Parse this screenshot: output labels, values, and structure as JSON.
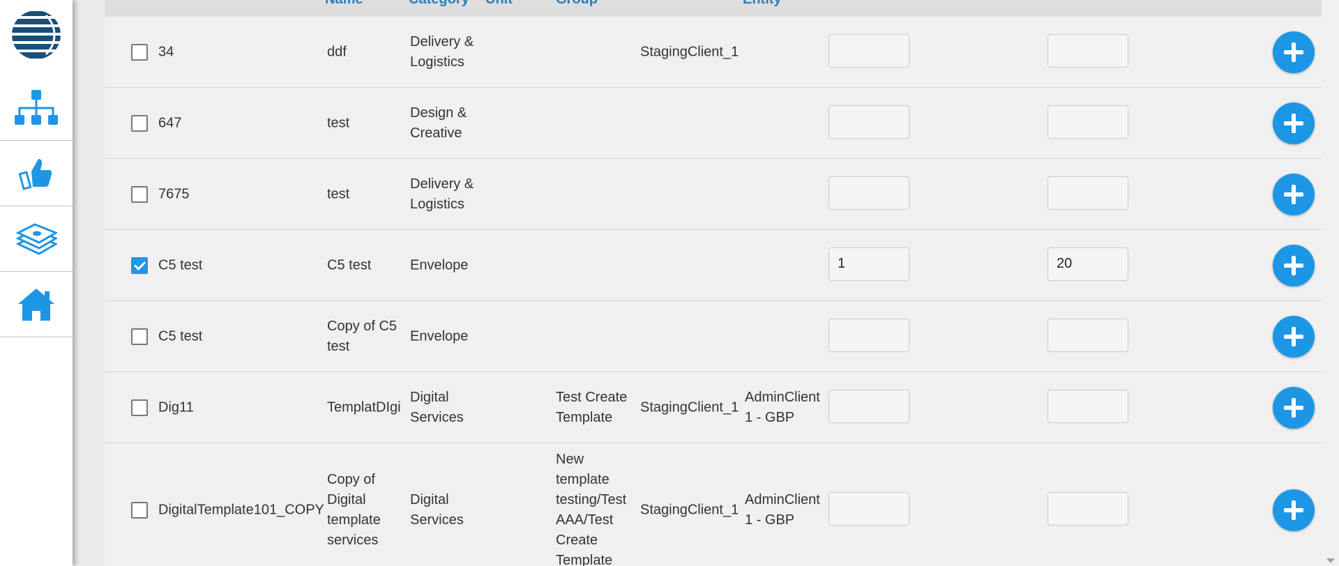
{
  "table": {
    "headers": {
      "name": "Name",
      "category": "Category",
      "unit": "Unit",
      "group": "Group",
      "entity": "Entity"
    },
    "rows": [
      {
        "code": "34",
        "name": "ddf",
        "category": "Delivery & Logistics",
        "group": "",
        "client": "StagingClient_1",
        "entity": "",
        "qty": "",
        "price": "",
        "checked": false
      },
      {
        "code": "647",
        "name": "test",
        "category": "Design & Creative",
        "group": "",
        "client": "",
        "entity": "",
        "qty": "",
        "price": "",
        "checked": false
      },
      {
        "code": "7675",
        "name": "test",
        "category": "Delivery & Logistics",
        "group": "",
        "client": "",
        "entity": "",
        "qty": "",
        "price": "",
        "checked": false
      },
      {
        "code": "C5 test",
        "name": "C5 test",
        "category": "Envelope",
        "group": "",
        "client": "",
        "entity": "",
        "qty": "1",
        "price": "20",
        "checked": true
      },
      {
        "code": "C5 test",
        "name": "Copy of C5 test",
        "category": "Envelope",
        "group": "",
        "client": "",
        "entity": "",
        "qty": "",
        "price": "",
        "checked": false
      },
      {
        "code": "Dig11",
        "name": "TemplatDIgi",
        "category": "Digital Services",
        "group": "Test Create Template",
        "client": "StagingClient_1",
        "entity": "AdminClient 1 - GBP",
        "qty": "",
        "price": "",
        "checked": false
      },
      {
        "code": "DigitalTemplate101_COPY",
        "name": "Copy of Digital template services",
        "category": "Digital Services",
        "group": "New template testing/Test AAA/Test Create Template",
        "client": "StagingClient_1",
        "entity": "AdminClient 1 - GBP",
        "qty": "",
        "price": "",
        "checked": false
      }
    ]
  },
  "sidebar": {
    "items": [
      {
        "icon": "hierarchy-icon"
      },
      {
        "icon": "thumbs-up-icon"
      },
      {
        "icon": "money-stack-icon"
      },
      {
        "icon": "home-icon"
      }
    ]
  },
  "colors": {
    "accent": "#1e96e6",
    "header_text": "#2b7fb8",
    "row_bg": "#f0f0f0",
    "logo": "#1a4f7a"
  }
}
